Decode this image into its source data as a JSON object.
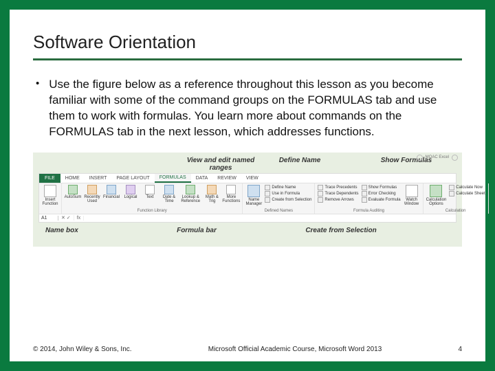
{
  "title": "Software Orientation",
  "bullet": "Use the figure below as a reference throughout this lesson as you become familiar with some of the command groups on the FORMULAS tab and use them to work with formulas. You learn more about commands on the FORMULAS tab in the next lesson, which addresses functions.",
  "callouts": {
    "top": {
      "view_edit": "View and edit named ranges",
      "define_name": "Define Name",
      "show_formulas": "Show Formulas"
    },
    "bottom": {
      "name_box": "Name box",
      "formula_bar": "Formula bar",
      "create_from_selection": "Create from Selection"
    }
  },
  "ribbon": {
    "file_tab": "FILE",
    "tabs": [
      "HOME",
      "INSERT",
      "PAGE LAYOUT",
      "FORMULAS",
      "DATA",
      "REVIEW",
      "VIEW"
    ],
    "active_tab": "FORMULAS",
    "badge": "MOAC Excel",
    "groups": {
      "insert_function": {
        "label": "Insert Function",
        "btn": "Insert Function"
      },
      "library": {
        "label": "Function Library",
        "buttons": [
          "AutoSum",
          "Recently Used",
          "Financial",
          "Logical",
          "Text",
          "Date & Time",
          "Lookup & Reference",
          "Math & Trig",
          "More Functions"
        ]
      },
      "defined_names": {
        "label": "Defined Names",
        "name_manager": "Name Manager",
        "items": [
          "Define Name",
          "Use in Formula",
          "Create from Selection"
        ]
      },
      "auditing": {
        "label": "Formula Auditing",
        "left": [
          "Trace Precedents",
          "Trace Dependents",
          "Remove Arrows"
        ],
        "right": [
          "Show Formulas",
          "Error Checking",
          "Evaluate Formula"
        ],
        "watch": "Watch Window"
      },
      "calculation": {
        "label": "Calculation",
        "options": "Calculation Options",
        "items": [
          "Calculate Now",
          "Calculate Sheet"
        ]
      }
    },
    "formula_bar": {
      "name_box_value": "A1",
      "fx_label": "fx",
      "controls": "✕ ✓"
    }
  },
  "footer": {
    "left": "© 2014, John Wiley & Sons, Inc.",
    "center": "Microsoft Official Academic Course, Microsoft Word 2013",
    "right": "4"
  }
}
